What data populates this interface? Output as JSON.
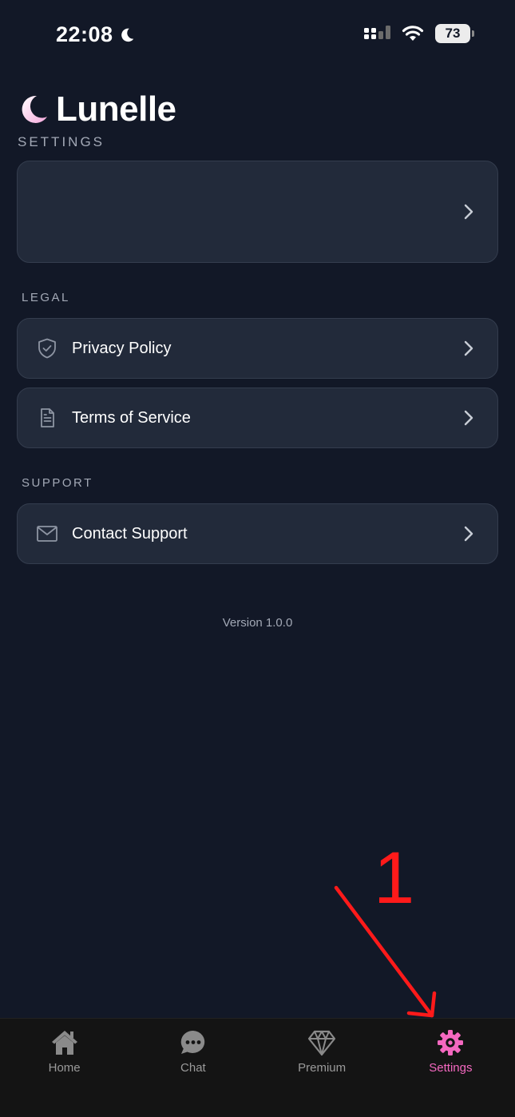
{
  "status_bar": {
    "time": "22:08",
    "battery": "73"
  },
  "header": {
    "app_name": "Lunelle",
    "page_title": "SETTINGS"
  },
  "sections": {
    "legal": {
      "title": "LEGAL",
      "items": [
        {
          "label": "Privacy Policy",
          "icon": "shield-check-icon"
        },
        {
          "label": "Terms of Service",
          "icon": "document-icon"
        }
      ]
    },
    "support": {
      "title": "SUPPORT",
      "items": [
        {
          "label": "Contact Support",
          "icon": "mail-icon"
        }
      ]
    }
  },
  "version": "Version 1.0.0",
  "annotation": {
    "number": "1",
    "color": "#ff1a1a"
  },
  "tab_bar": {
    "tabs": [
      {
        "label": "Home",
        "icon": "home-icon"
      },
      {
        "label": "Chat",
        "icon": "chat-bubble-icon"
      },
      {
        "label": "Premium",
        "icon": "diamond-icon"
      },
      {
        "label": "Settings",
        "icon": "gear-icon",
        "active": true
      }
    ]
  },
  "colors": {
    "background": "#121827",
    "card": "#222a3a",
    "accent_pink": "#f468c0",
    "muted_text": "#a3a9b6"
  }
}
